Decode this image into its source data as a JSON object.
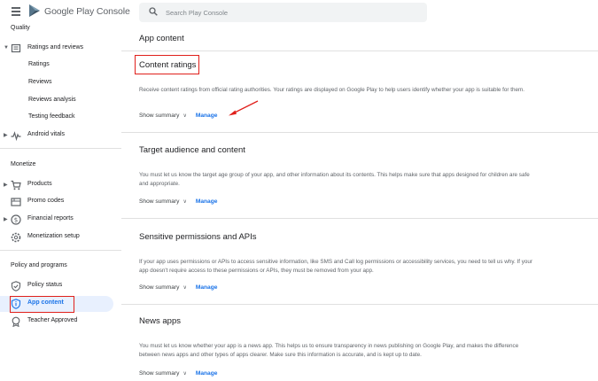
{
  "app": {
    "brand": "Google Play Console"
  },
  "search": {
    "placeholder": "Search Play Console"
  },
  "sidebar": {
    "quality_title": "Quality",
    "ratings_reviews": "Ratings and reviews",
    "ratings": "Ratings",
    "reviews": "Reviews",
    "reviews_analysis": "Reviews analysis",
    "testing_feedback": "Testing feedback",
    "android_vitals": "Android vitals",
    "monetize_title": "Monetize",
    "products": "Products",
    "promo_codes": "Promo codes",
    "financial_reports": "Financial reports",
    "monetization_setup": "Monetization setup",
    "policy_title": "Policy and programs",
    "policy_status": "Policy status",
    "app_content": "App content",
    "teacher_approved": "Teacher Approved"
  },
  "main": {
    "title": "App content",
    "sections": [
      {
        "title": "Content ratings",
        "desc": "Receive content ratings from official rating authorities. Your ratings are displayed on Google Play to help users identify whether your app is suitable for them.",
        "summary": "Show summary",
        "manage": "Manage"
      },
      {
        "title": "Target audience and content",
        "desc": "You must let us know the target age group of your app, and other information about its contents. This helps make sure that apps designed for children are safe and appropriate.",
        "summary": "Show summary",
        "manage": "Manage"
      },
      {
        "title": "Sensitive permissions and APIs",
        "desc": "If your app uses permissions or APIs to access sensitive information, like SMS and Call log permissions or accessibility services, you need to tell us why. If your app doesn't require access to these permissions or APIs, they must be removed from your app.",
        "summary": "Show summary",
        "manage": "Manage"
      },
      {
        "title": "News apps",
        "desc": "You must let us know whether your app is a news app. This helps us to ensure transparency in news publishing on Google Play, and makes the difference between news apps and other types of apps clearer. Make sure this information is accurate, and is kept up to date.",
        "summary": "Show summary",
        "manage": "Manage"
      }
    ]
  },
  "colors": {
    "accent": "#1a73e8",
    "highlight": "#e0201b",
    "active_bg": "#e8f0fe"
  }
}
